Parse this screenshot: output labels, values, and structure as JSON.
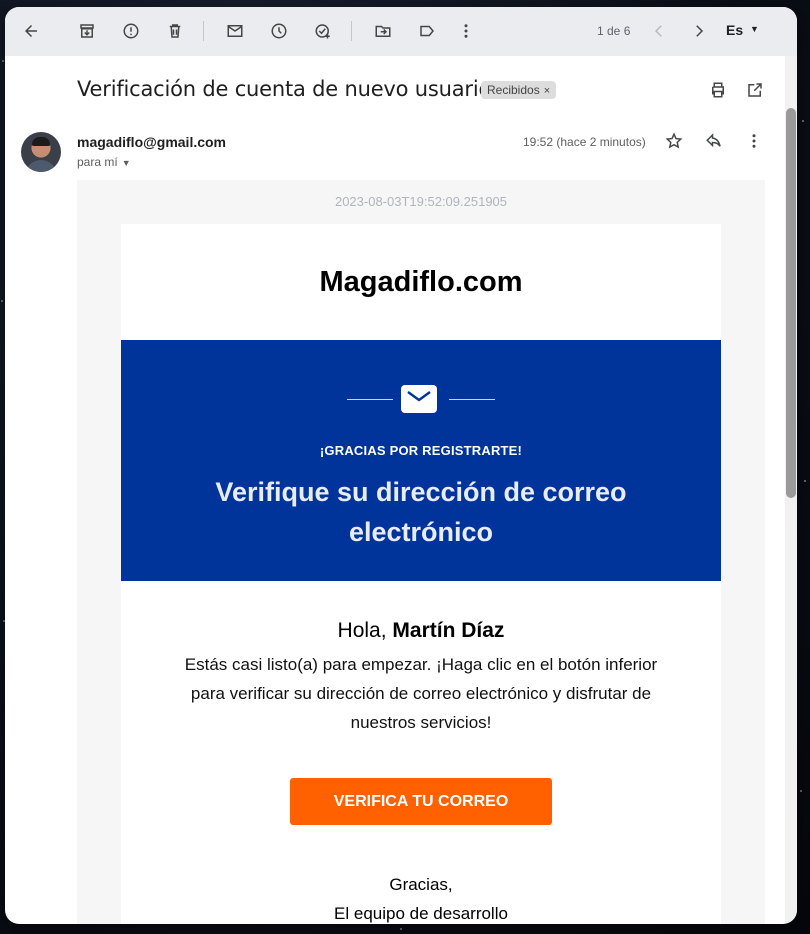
{
  "toolbar": {
    "back_icon": "arrow-left-icon",
    "archive_icon": "archive-icon",
    "report_icon": "report-spam-icon",
    "delete_icon": "trash-icon",
    "mark_unread_icon": "envelope-icon",
    "snooze_icon": "clock-icon",
    "add_task_icon": "add-task-icon",
    "move_icon": "move-to-folder-icon",
    "label_icon": "label-icon",
    "more_icon": "more-vertical-icon",
    "pager": "1 de 6",
    "prev_icon": "chevron-left-icon",
    "next_icon": "chevron-right-icon",
    "language": "Es"
  },
  "message": {
    "subject": "Verificación de cuenta de nuevo usuario",
    "label": "Recibidos",
    "label_close": "×",
    "sender": "magadiflo@gmail.com",
    "to": "para mí",
    "time": "19:52 (hace 2 minutos)"
  },
  "email": {
    "timestamp": "2023-08-03T19:52:09.251905",
    "brand": "Magadiflo.com",
    "thanks": "¡GRACIAS POR REGISTRARTE!",
    "headline": "Verifique su dirección de correo electrónico",
    "greeting_prefix": "Hola,",
    "greeting_name": "Martín Díaz",
    "body": "Estás casi listo(a) para empezar. ¡Haga clic en el botón inferior para verificar su dirección de correo electrónico y disfrutar de nuestros servicios!",
    "cta": "VERIFICA TU CORREO",
    "signoff_line1": "Gracias,",
    "signoff_line2": "El equipo de desarrollo"
  },
  "colors": {
    "banner": "#00349a",
    "cta": "#ff6100",
    "toolbar": "#eaecf0"
  }
}
